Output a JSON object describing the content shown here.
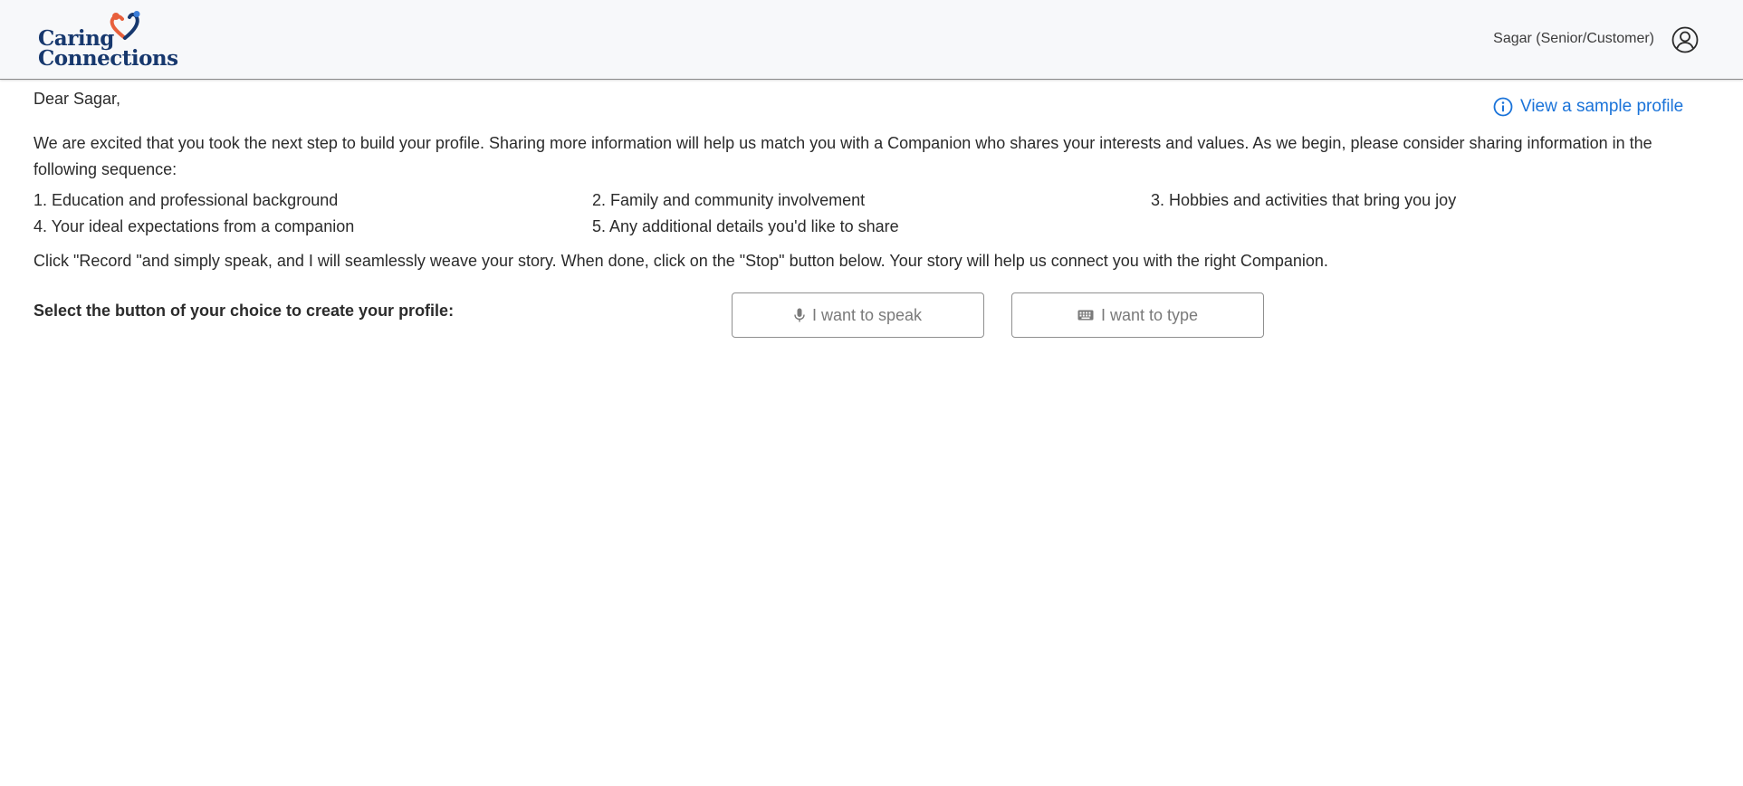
{
  "header": {
    "logo": {
      "line1": "Caring",
      "line2": "Connections",
      "text_color": "#17386e",
      "heart_color": "#e8603c",
      "person_color": "#17386e"
    },
    "user_name": "Sagar (Senior/Customer)",
    "avatar_icon": "user-circle-icon"
  },
  "main": {
    "greeting": "Dear Sagar,",
    "sample_link": {
      "label": "View a sample profile",
      "icon": "info-circle-icon",
      "color": "#1a73d9"
    },
    "intro": "We are excited that you took the next step to build your profile. Sharing more information will help us match you with a Companion who shares your interests and values. As we begin, please consider sharing information in the following sequence:",
    "steps": [
      "1. Education and professional background",
      "2. Family and community involvement",
      "3. Hobbies and activities that bring you joy",
      "4. Your ideal expectations from a companion",
      "5. Any additional details you'd like to share"
    ],
    "click_info": "Click \"Record \"and simply speak, and I will seamlessly weave your story. When done, click on the \"Stop\" button below. Your story will help us connect you with the right Companion.",
    "select_label": "Select the button of your choice to create your profile:",
    "buttons": {
      "speak": {
        "label": "I want to speak",
        "icon": "microphone-icon"
      },
      "type": {
        "label": "I want to type",
        "icon": "keyboard-icon"
      }
    }
  }
}
